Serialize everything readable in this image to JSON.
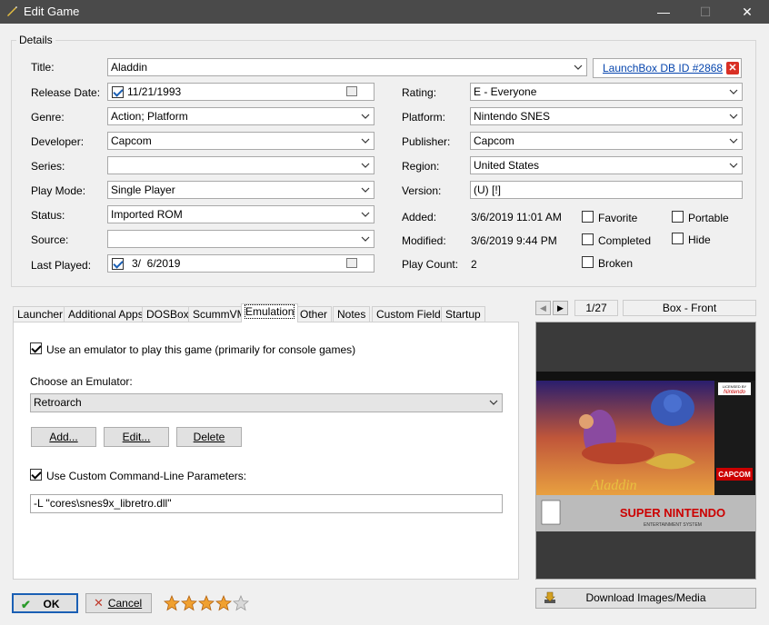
{
  "window": {
    "title": "Edit Game",
    "minimize": "—",
    "maximize": "☐",
    "close": "✕"
  },
  "details": {
    "legend": "Details",
    "title_label": "Title:",
    "title_value": "Aladdin",
    "db_link": "LaunchBox DB ID #2868",
    "release_label": "Release Date:",
    "release_value": "11/21/1993",
    "genre_label": "Genre:",
    "genre_value": "Action; Platform",
    "developer_label": "Developer:",
    "developer_value": "Capcom",
    "series_label": "Series:",
    "series_value": "",
    "playmode_label": "Play Mode:",
    "playmode_value": "Single Player",
    "status_label": "Status:",
    "status_value": "Imported ROM",
    "source_label": "Source:",
    "source_value": "",
    "lastplayed_label": "Last Played:",
    "lastplayed_value": "3/  6/2019",
    "rating_label": "Rating:",
    "rating_value": "E - Everyone",
    "platform_label": "Platform:",
    "platform_value": "Nintendo SNES",
    "publisher_label": "Publisher:",
    "publisher_value": "Capcom",
    "region_label": "Region:",
    "region_value": "United States",
    "version_label": "Version:",
    "version_value": "(U) [!]",
    "added_label": "Added:",
    "added_value": "3/6/2019 11:01 AM",
    "modified_label": "Modified:",
    "modified_value": "3/6/2019 9:44 PM",
    "playcount_label": "Play Count:",
    "playcount_value": "2",
    "favorite": "Favorite",
    "completed": "Completed",
    "broken": "Broken",
    "portable": "Portable",
    "hide": "Hide"
  },
  "tabs": [
    "Launcher",
    "Additional Apps",
    "DOSBox",
    "ScummVM",
    "Emulation",
    "Other",
    "Notes",
    "Custom Fields",
    "Startup"
  ],
  "emulation": {
    "use_emulator": "Use an emulator to play this game (primarily for console games)",
    "choose_label": "Choose an Emulator:",
    "emulator_value": "Retroarch",
    "add": "Add...",
    "edit": "Edit...",
    "delete": "Delete",
    "use_custom": "Use Custom Command-Line Parameters:",
    "params_value": "-L \"cores\\snes9x_libretro.dll\""
  },
  "image": {
    "counter": "1/27",
    "type": "Box - Front",
    "download": "Download Images/Media",
    "boxart_brand": "SUPER NINTENDO",
    "boxart_sub": "ENTERTAINMENT SYSTEM",
    "boxart_title": "Aladdin",
    "boxart_publisher": "CAPCOM",
    "boxart_licensed": "LICENSED BY",
    "boxart_nintendo": "Nintendo"
  },
  "footer": {
    "ok": "OK",
    "cancel": "Cancel",
    "rating_stars": 4,
    "rating_max": 5
  },
  "colors": {
    "titlebar": "#4a4a4a",
    "link": "#0645ad",
    "accent": "#1a5fb4"
  }
}
